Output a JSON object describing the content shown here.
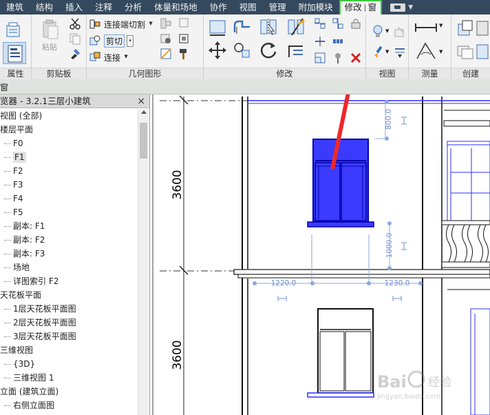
{
  "menu": {
    "items": [
      "建筑",
      "结构",
      "插入",
      "注释",
      "分析",
      "体量和场地",
      "协作",
      "视图",
      "管理",
      "附加模块"
    ],
    "active_tab": "修改",
    "active_context": "窗"
  },
  "ribbon": {
    "panels": {
      "properties": "属性",
      "clipboard": "剪贴板",
      "geometry": "几何图形",
      "modify": "修改",
      "view": "视图",
      "measure": "测量",
      "create": "创建"
    },
    "paste_label": "粘贴",
    "join_cut_label": "连接端切割",
    "cut_label": "剪切",
    "join_label": "连接"
  },
  "strip": {
    "title": "窗"
  },
  "browser": {
    "title": "览器 - 3.2.1三层小建筑",
    "close_icon": "×",
    "items": [
      {
        "label": "视图 (全部)",
        "level": 0
      },
      {
        "label": "楼层平面",
        "level": 0
      },
      {
        "label": "F0",
        "level": 1
      },
      {
        "label": "F1",
        "level": 1,
        "selected": true
      },
      {
        "label": "F2",
        "level": 1
      },
      {
        "label": "F3",
        "level": 1
      },
      {
        "label": "F4",
        "level": 1
      },
      {
        "label": "F5",
        "level": 1
      },
      {
        "label": "副本: F1",
        "level": 1
      },
      {
        "label": "副本: F2",
        "level": 1
      },
      {
        "label": "副本: F3",
        "level": 1
      },
      {
        "label": "场地",
        "level": 1
      },
      {
        "label": "详图索引 F2",
        "level": 1
      },
      {
        "label": "天花板平面",
        "level": 0
      },
      {
        "label": "1层天花板平面图",
        "level": 1
      },
      {
        "label": "2层天花板平面图",
        "level": 1
      },
      {
        "label": "3层天花板平面图",
        "level": 1
      },
      {
        "label": "三维视图",
        "level": 0
      },
      {
        "label": "{3D}",
        "level": 1
      },
      {
        "label": "三维视图 1",
        "level": 1
      },
      {
        "label": "立面 (建筑立面)",
        "level": 0
      },
      {
        "label": "右侧立面图",
        "level": 1
      }
    ]
  },
  "drawing": {
    "dim_left_top": "3600",
    "dim_left_bottom": "3600",
    "dim_window_top": "800.0",
    "dim_window_bottom": "1000.0",
    "dim_left_width": "1220.0",
    "dim_right_width": "1230.0",
    "watermark_brand": "Bai",
    "watermark_brand2": "经验",
    "watermark_url": "jingyan.baidu.com",
    "colors": {
      "selected_window": "#2d2dff",
      "dimension": "#6e8fd0",
      "annotation_arrow": "#f02828"
    }
  }
}
